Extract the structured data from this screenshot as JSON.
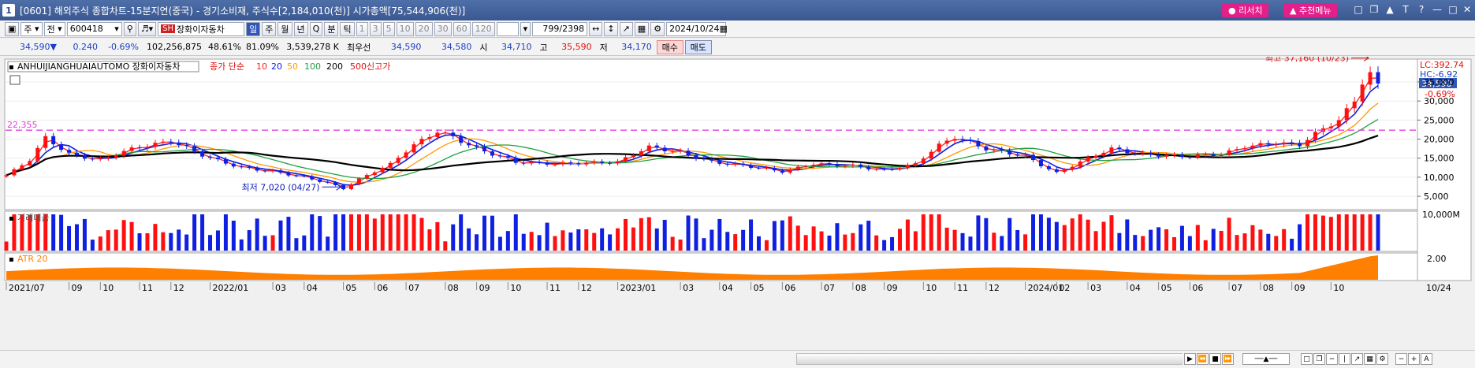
{
  "window": {
    "number": "1",
    "title": "[0601] 해외주식 종합차트-15분지연(중국) - 경기소비재, 주식수[2,184,010(천)] 시가총액[75,544,906(천)]",
    "research_label": "리서치",
    "recommend_label": "추천메뉴"
  },
  "toolbar": {
    "period_mode": "주",
    "prev_label": "전",
    "code": "600418",
    "market_tag": "SH",
    "stock_name": "장화이자동차",
    "period_buttons": [
      "일",
      "주",
      "월",
      "년",
      "Q",
      "분",
      "틱"
    ],
    "minute_buttons": [
      "1",
      "3",
      "5",
      "10",
      "20",
      "30",
      "60",
      "120"
    ],
    "count": "799",
    "total": "/2398",
    "date": "2024/10/24"
  },
  "quote": {
    "price": "34,590",
    "arrow": "▼",
    "change": "0.240",
    "change_pct": "-0.69%",
    "volume": "102,256,875",
    "ratio1": "48.61%",
    "ratio2": "81.09%",
    "amount": "3,539,278 K",
    "best_ask_label": "최우선",
    "best_ask": "34,590",
    "best_bid": "34,580",
    "open_label": "시",
    "open": "34,710",
    "high_label": "고",
    "high": "35,590",
    "low_label": "저",
    "low": "34,170",
    "buy_label": "매수",
    "sell_label": "매도"
  },
  "chart_data": {
    "type": "line",
    "title": "ANHUIJIANGHUAIAUTOMO  장화이자동차",
    "legend": {
      "series_label": "종가 단순",
      "ma_periods": [
        "10",
        "20",
        "50",
        "100",
        "200"
      ],
      "ma_colors": [
        "#ff2020",
        "#1020e0",
        "#ff9900",
        "#20a040",
        "#000000"
      ],
      "high52": "500신고가"
    },
    "axis_tags": {
      "lc": "LC:392.74",
      "hc": "HC:-6.92"
    },
    "price_axis_ticks": [
      "35,000",
      "30,000",
      "25,000",
      "20,000",
      "15,000",
      "10,000",
      "5,000"
    ],
    "price_ylim": [
      1500,
      41000
    ],
    "current_price": "34,590",
    "current_change": "-0.69%",
    "horizontal_line": {
      "label": "22,355",
      "value": 22355,
      "color": "#e040e0"
    },
    "annotation_high": "최고 37,160 (10/23)",
    "annotation_low": "최저 7,020 (04/27)",
    "x_labels": [
      "2021/07",
      "09",
      "10",
      "11",
      "12",
      "2022/01",
      "03",
      "04",
      "05",
      "06",
      "07",
      "08",
      "09",
      "10",
      "11",
      "12",
      "2023/01",
      "03",
      "04",
      "05",
      "06",
      "07",
      "08",
      "09",
      "10",
      "11",
      "12",
      "2024/01",
      "02",
      "03",
      "04",
      "05",
      "06",
      "07",
      "08",
      "09",
      "10",
      "10/24"
    ],
    "x_label_weeks": [
      0,
      8,
      12,
      17,
      21,
      26,
      34,
      38,
      43,
      47,
      51,
      56,
      60,
      64,
      69,
      73,
      78,
      86,
      91,
      95,
      99,
      104,
      108,
      112,
      117,
      121,
      125,
      130,
      134,
      138,
      143,
      147,
      151,
      156,
      160,
      164,
      169
    ],
    "keypoints": [
      [
        0,
        10500
      ],
      [
        3,
        14500
      ],
      [
        5,
        20500
      ],
      [
        8,
        16000
      ],
      [
        12,
        14500
      ],
      [
        16,
        17500
      ],
      [
        21,
        19500
      ],
      [
        26,
        15000
      ],
      [
        30,
        12500
      ],
      [
        34,
        11500
      ],
      [
        38,
        10000
      ],
      [
        41,
        8500
      ],
      [
        43,
        7020
      ],
      [
        45,
        9500
      ],
      [
        49,
        13500
      ],
      [
        52,
        18500
      ],
      [
        55,
        22000
      ],
      [
        57,
        20500
      ],
      [
        60,
        17500
      ],
      [
        65,
        14000
      ],
      [
        70,
        13500
      ],
      [
        78,
        14000
      ],
      [
        82,
        18000
      ],
      [
        86,
        16500
      ],
      [
        90,
        14000
      ],
      [
        95,
        12800
      ],
      [
        99,
        11500
      ],
      [
        103,
        13500
      ],
      [
        108,
        13000
      ],
      [
        112,
        11800
      ],
      [
        116,
        13500
      ],
      [
        119,
        18500
      ],
      [
        121,
        20500
      ],
      [
        125,
        17500
      ],
      [
        130,
        15500
      ],
      [
        134,
        11000
      ],
      [
        138,
        15000
      ],
      [
        141,
        17500
      ],
      [
        145,
        16000
      ],
      [
        150,
        15500
      ],
      [
        155,
        16000
      ],
      [
        158,
        18000
      ],
      [
        162,
        19000
      ],
      [
        165,
        18500
      ],
      [
        167,
        21500
      ],
      [
        170,
        25000
      ],
      [
        172,
        30000
      ],
      [
        173,
        35000
      ],
      [
        174,
        37160
      ],
      [
        175,
        34590
      ]
    ],
    "volume_panel": {
      "label": "거래대금",
      "tick": "10,000M"
    },
    "atr_panel": {
      "label": "ATR 20",
      "tick": "2.00"
    }
  }
}
